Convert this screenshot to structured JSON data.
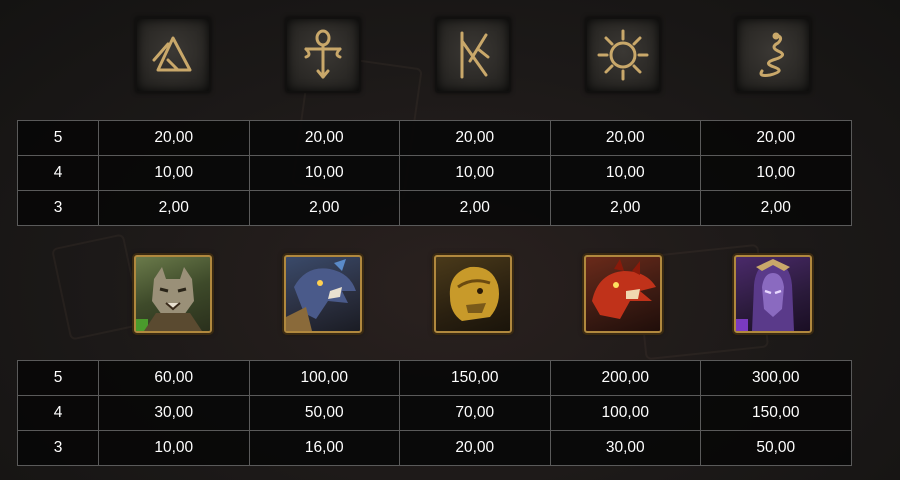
{
  "rune_symbols": [
    {
      "name": "triangle-rune-icon"
    },
    {
      "name": "ankh-rune-icon"
    },
    {
      "name": "crossed-lines-rune-icon"
    },
    {
      "name": "sun-rune-icon"
    },
    {
      "name": "serpent-rune-icon"
    }
  ],
  "rune_paytable": {
    "rows": [
      {
        "count": "5",
        "values": [
          "20,00",
          "20,00",
          "20,00",
          "20,00",
          "20,00"
        ]
      },
      {
        "count": "4",
        "values": [
          "10,00",
          "10,00",
          "10,00",
          "10,00",
          "10,00"
        ]
      },
      {
        "count": "3",
        "values": [
          "2,00",
          "2,00",
          "2,00",
          "2,00",
          "2,00"
        ]
      }
    ]
  },
  "character_symbols": [
    {
      "name": "wolf-warrior-icon",
      "frame_color": "#4a9a2c"
    },
    {
      "name": "blue-dragon-icon",
      "frame_color": "#3a5ab0"
    },
    {
      "name": "gold-beast-icon",
      "frame_color": "#c89a2a"
    },
    {
      "name": "red-dragon-icon",
      "frame_color": "#c0321a"
    },
    {
      "name": "purple-sorcerer-icon",
      "frame_color": "#7a3ac0"
    }
  ],
  "character_paytable": {
    "rows": [
      {
        "count": "5",
        "values": [
          "60,00",
          "100,00",
          "150,00",
          "200,00",
          "300,00"
        ]
      },
      {
        "count": "4",
        "values": [
          "30,00",
          "50,00",
          "70,00",
          "100,00",
          "150,00"
        ]
      },
      {
        "count": "3",
        "values": [
          "10,00",
          "16,00",
          "20,00",
          "30,00",
          "50,00"
        ]
      }
    ]
  }
}
